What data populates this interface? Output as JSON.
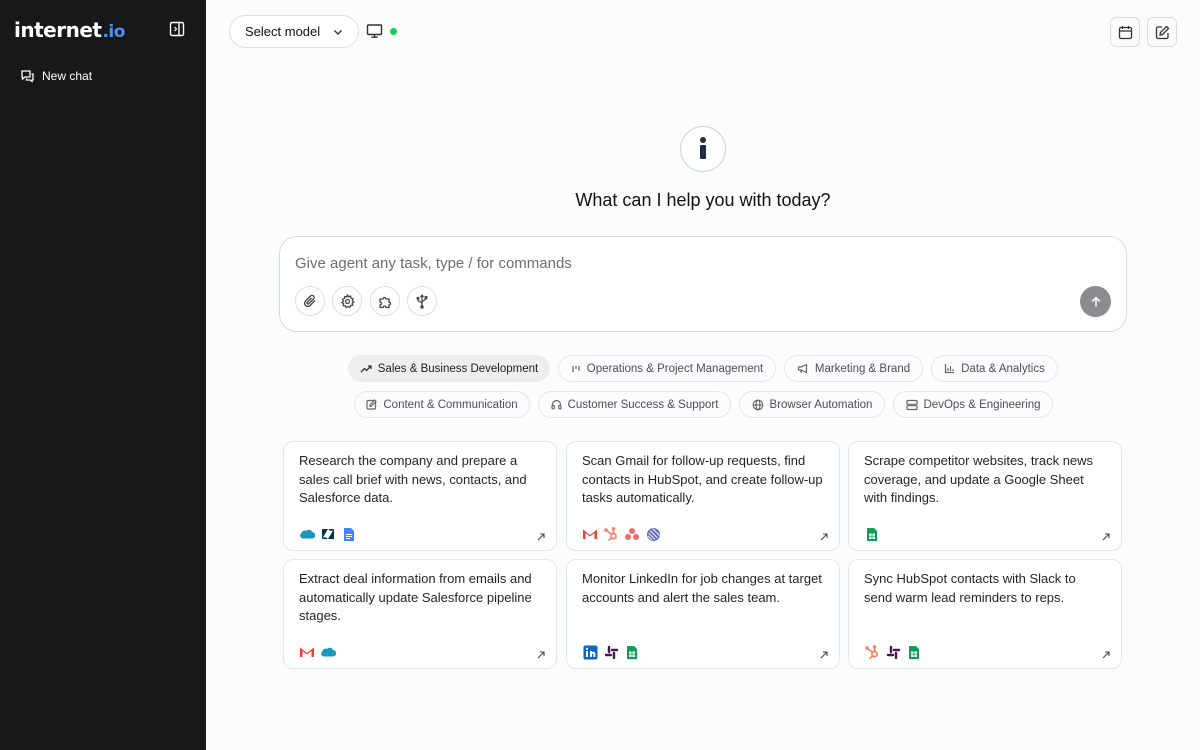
{
  "sidebar": {
    "logo_main": "internet",
    "logo_tld": ".io",
    "new_chat_label": "New chat"
  },
  "topbar": {
    "model_select_label": "Select model",
    "status_color": "#22c55e"
  },
  "hero": {
    "logo_glyph": "i",
    "title": "What can I help you with today?"
  },
  "prompt": {
    "placeholder": "Give agent any task, type / for commands",
    "tools": [
      "paperclip-icon",
      "gear-icon",
      "puzzle-icon",
      "usb-icon"
    ]
  },
  "categories": [
    {
      "label": "Sales & Business Development",
      "icon": "trending-up-icon",
      "active": true
    },
    {
      "label": "Operations & Project Management",
      "icon": "kanban-icon",
      "active": false
    },
    {
      "label": "Marketing & Brand",
      "icon": "megaphone-icon",
      "active": false
    },
    {
      "label": "Data & Analytics",
      "icon": "bar-chart-icon",
      "active": false
    },
    {
      "label": "Content & Communication",
      "icon": "edit-icon",
      "active": false
    },
    {
      "label": "Customer Success & Support",
      "icon": "headphones-icon",
      "active": false
    },
    {
      "label": "Browser Automation",
      "icon": "globe-icon",
      "active": false
    },
    {
      "label": "DevOps & Engineering",
      "icon": "server-icon",
      "active": false
    }
  ],
  "cards": [
    {
      "text": "Research the company and prepare a sales call brief with news, contacts, and Salesforce data.",
      "apps": [
        "salesforce-icon",
        "zendesk-icon",
        "google-docs-icon"
      ]
    },
    {
      "text": "Scan Gmail for follow-up requests, find contacts in HubSpot, and create follow-up tasks automatically.",
      "apps": [
        "gmail-icon",
        "hubspot-icon",
        "asana-icon",
        "linear-icon"
      ]
    },
    {
      "text": "Scrape competitor websites, track news coverage, and update a Google Sheet with findings.",
      "apps": [
        "google-sheets-icon"
      ]
    },
    {
      "text": "Extract deal information from emails and automatically update Salesforce pipeline stages.",
      "apps": [
        "gmail-icon",
        "salesforce-icon"
      ]
    },
    {
      "text": "Monitor LinkedIn for job changes at target accounts and alert the sales team.",
      "apps": [
        "linkedin-icon",
        "slack-icon",
        "google-sheets-icon"
      ]
    },
    {
      "text": "Sync HubSpot contacts with Slack to send warm lead reminders to reps.",
      "apps": [
        "hubspot-icon",
        "slack-icon",
        "google-sheets-icon"
      ]
    }
  ],
  "colors": {
    "sidebar_bg": "#18181b",
    "logo_accent": "#4f8ff7",
    "send_button": "#8b8c8f"
  }
}
